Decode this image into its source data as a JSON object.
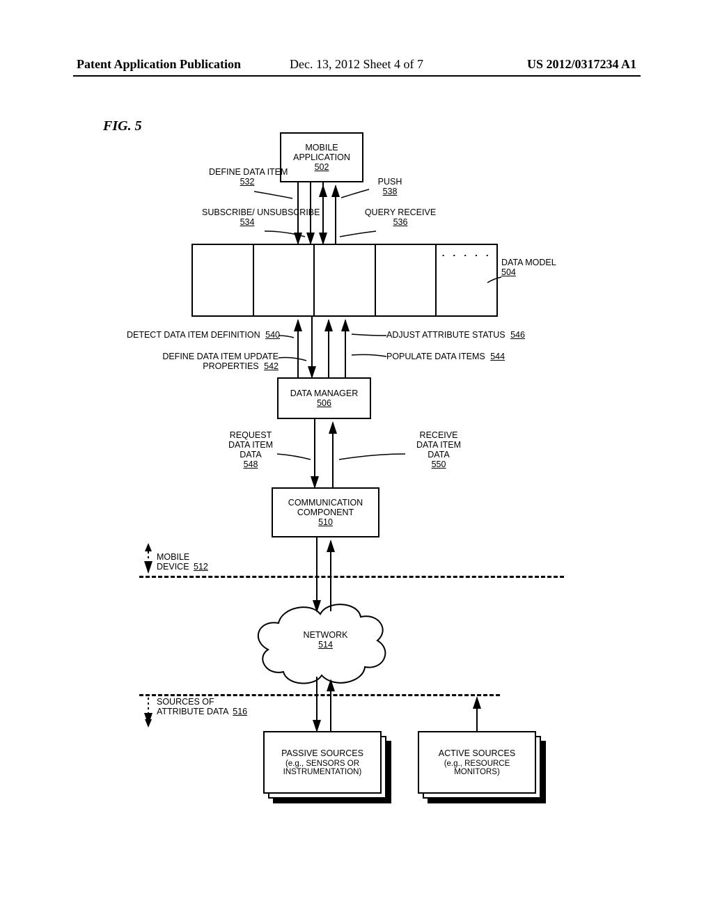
{
  "header": {
    "left": "Patent Application Publication",
    "mid": "Dec. 13, 2012  Sheet 4 of 7",
    "right": "US 2012/0317234 A1"
  },
  "figure_title": "FIG. 5",
  "boxes": {
    "mobile_app": {
      "title": "MOBILE APPLICATION",
      "ref": "502"
    },
    "data_manager": {
      "title": "DATA MANAGER",
      "ref": "506"
    },
    "comm_component": {
      "title": "COMMUNICATION COMPONENT",
      "ref": "510"
    },
    "network": {
      "title": "NETWORK",
      "ref": "514"
    },
    "passive_sources": {
      "title": "PASSIVE SOURCES",
      "sub": "(e.g., SENSORS OR INSTRUMENTATION)"
    },
    "active_sources": {
      "title": "ACTIVE SOURCES",
      "sub": "(e.g., RESOURCE MONITORS)"
    }
  },
  "data_model": {
    "ellipsis": ". . . . .",
    "label": "DATA MODEL",
    "ref": "504"
  },
  "labels": {
    "define_data_item": {
      "text": "DEFINE DATA ITEM",
      "ref": "532"
    },
    "subscribe": {
      "text": "SUBSCRIBE/ UNSUBSCRIBE",
      "ref": "534"
    },
    "query_receive": {
      "text": "QUERY RECEIVE",
      "ref": "536"
    },
    "push": {
      "text": "PUSH",
      "ref": "538"
    },
    "detect_def": {
      "text": "DETECT DATA ITEM DEFINITION",
      "ref": "540"
    },
    "define_update": {
      "text": "DEFINE DATA ITEM UPDATE PROPERTIES",
      "ref": "542"
    },
    "populate": {
      "text": "POPULATE DATA ITEMS",
      "ref": "544"
    },
    "adjust": {
      "text": "ADJUST ATTRIBUTE STATUS",
      "ref": "546"
    },
    "request": {
      "text1": "REQUEST",
      "text2": "DATA ITEM",
      "text3": "DATA",
      "ref": "548"
    },
    "receive": {
      "text1": "RECEIVE",
      "text2": "DATA ITEM",
      "text3": "DATA",
      "ref": "550"
    },
    "mobile_device": {
      "text": "MOBILE",
      "text2": "DEVICE",
      "ref": "512"
    },
    "sources_of": {
      "text": "SOURCES OF",
      "text2": "ATTRIBUTE DATA",
      "ref": "516"
    }
  }
}
